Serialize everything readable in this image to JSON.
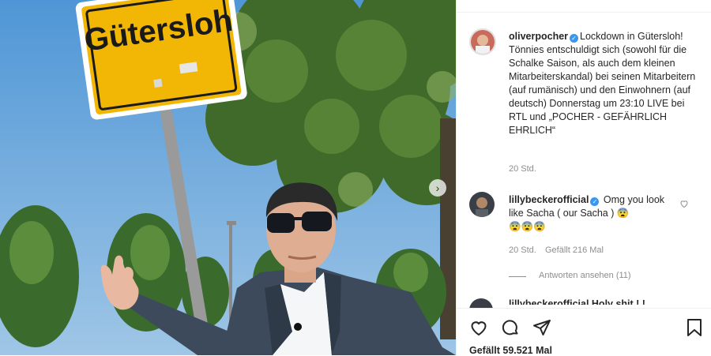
{
  "post": {
    "sign_text": "Gütersloh",
    "author": "oliverpocher",
    "caption": "Lockdown in Gütersloh!\nTönnies entschuldigt sich (sowohl für die Schalke Saison, als auch dem kleinen Mitarbeiterskandal) bei seinen Mitarbeitern (auf rumänisch) und den Einwohnern (auf deutsch) Donnerstag um 23:10 LIVE bei RTL und „POCHER - GEFÄHRLICH EHRLICH“",
    "time": "20 Std.",
    "likes": "Gefällt 59.521 Mal"
  },
  "comments": [
    {
      "user": "lillybeckerofficial",
      "text": "Omg you look like Sacha ( our Sacha ) 😨\n😨😨😨",
      "time": "20 Std.",
      "likes": "Gefällt 216 Mal",
      "replies": "Antworten ansehen (11)"
    }
  ],
  "next_comment_partial": "lillybeckerofficial   Holy shit ! !",
  "icons": {
    "verified": "verified-badge-icon",
    "like": "heart-icon",
    "comment": "comment-icon",
    "share": "paper-plane-icon",
    "save": "bookmark-icon",
    "next": "chevron-right-icon"
  },
  "colors": {
    "verified": "#3897f0",
    "sign": "#f2b705",
    "sky": "#6aa6d8"
  }
}
